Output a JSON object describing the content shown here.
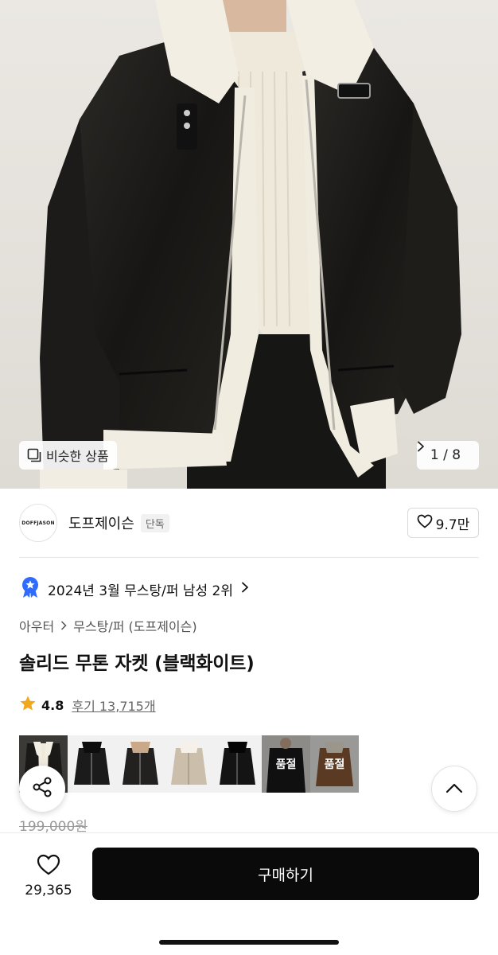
{
  "gallery": {
    "similar_label": "비슷한 상품",
    "counter": "1 / 8",
    "counter_current": 1,
    "counter_total": 8
  },
  "brand": {
    "logo_text": "DOFFJASON",
    "name": "도프제이슨",
    "badge": "단독",
    "like_count": "9.7만"
  },
  "ranking": {
    "text": "2024년 3월 무스탕/퍼 남성 2위"
  },
  "category": {
    "level1": "아우터",
    "level2": "무스탕/퍼 (도프제이슨)"
  },
  "product": {
    "title": "솔리드 무톤 자켓 (블랙화이트)",
    "rating": "4.8",
    "reviews": "후기 13,715개",
    "original_price": "199,000원"
  },
  "thumbnails": [
    {
      "variant": "model-shot",
      "soldout": false
    },
    {
      "variant": "black-fur",
      "soldout": false
    },
    {
      "variant": "black-beige",
      "soldout": false
    },
    {
      "variant": "beige-white",
      "soldout": false
    },
    {
      "variant": "black-black",
      "soldout": false
    },
    {
      "variant": "black-model",
      "soldout": true,
      "label": "품절"
    },
    {
      "variant": "brown",
      "soldout": true,
      "label": "품절"
    }
  ],
  "bottom_bar": {
    "wish_count": "29,365",
    "buy_label": "구매하기"
  },
  "colors": {
    "accent_black": "#0a0a0a",
    "star": "#f0a81d",
    "rank_badge": "#2f6bff"
  }
}
